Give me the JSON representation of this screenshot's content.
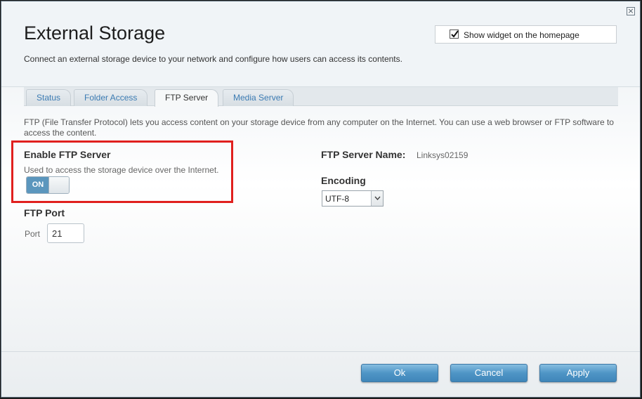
{
  "dialog": {
    "title": "External Storage",
    "subtitle": "Connect an external storage device to your network and configure how users can access its contents.",
    "close_icon": "×",
    "widget": {
      "label": "Show widget on the homepage",
      "checked": true
    }
  },
  "tabs": [
    {
      "label": "Status",
      "active": false
    },
    {
      "label": "Folder Access",
      "active": false
    },
    {
      "label": "FTP Server",
      "active": true
    },
    {
      "label": "Media Server",
      "active": false
    }
  ],
  "ftp": {
    "description": "FTP (File Transfer Protocol) lets you access content on your storage device from any computer on the Internet. You can use a web browser or FTP software to access the content.",
    "enable": {
      "title": "Enable FTP Server",
      "subtitle": "Used to access the storage device over the Internet.",
      "toggle_label": "ON",
      "enabled": true
    },
    "port": {
      "title": "FTP Port",
      "label": "Port",
      "value": "21"
    },
    "server_name": {
      "label": "FTP Server Name:",
      "value": "Linksys02159"
    },
    "encoding": {
      "label": "Encoding",
      "selected": "UTF-8"
    }
  },
  "buttons": {
    "ok": "Ok",
    "cancel": "Cancel",
    "apply": "Apply"
  },
  "colors": {
    "accent": "#4f95c6",
    "highlight": "#e0201e",
    "tab_link": "#3b7bb3"
  }
}
